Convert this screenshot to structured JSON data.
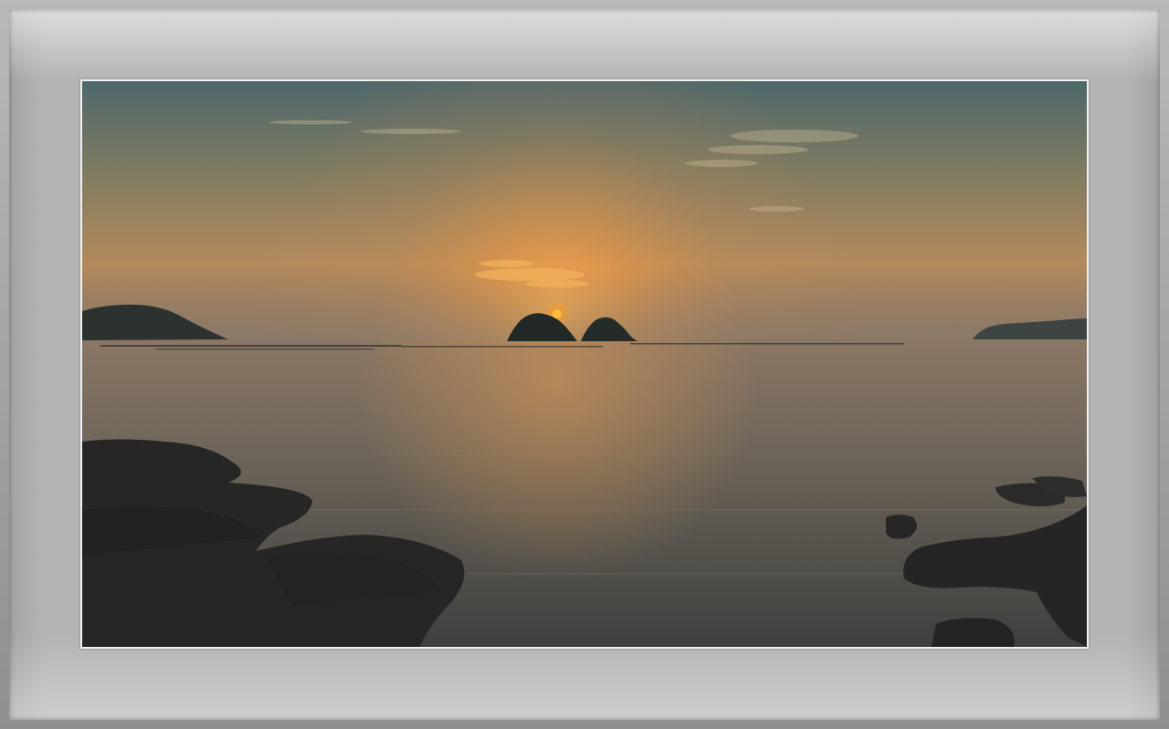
{
  "scene": {
    "subject": "sunset-over-sea",
    "colors": {
      "sky_top": "#4f6a6e",
      "sky_glow": "#e7a75a",
      "sun": "#ff9a1a",
      "sea": "#5f5a52",
      "rock": "#262626",
      "mat": "#b0b0b0",
      "border": "#f2f2f2"
    }
  }
}
